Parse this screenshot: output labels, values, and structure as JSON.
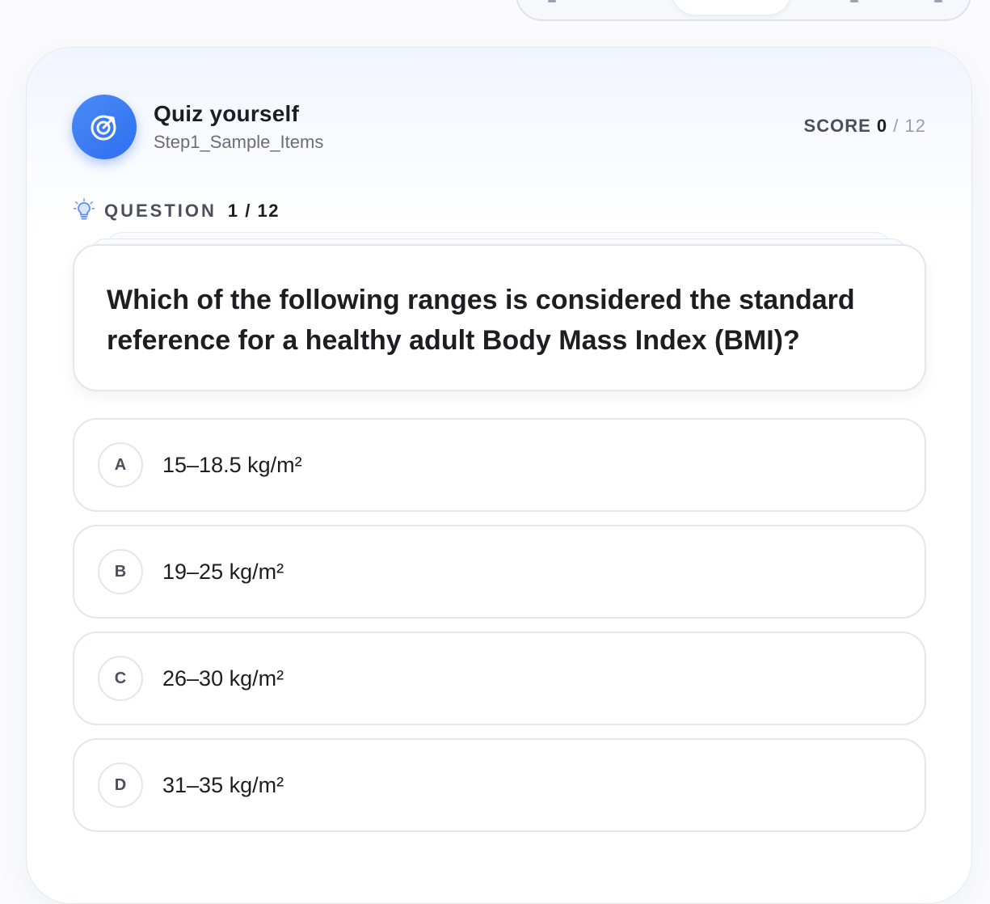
{
  "header": {
    "title": "Quiz yourself",
    "subtitle": "Step1_Sample_Items",
    "score_label": "SCORE",
    "score_value": "0",
    "score_total": "/ 12"
  },
  "question": {
    "label": "QUESTION",
    "number": "1 / 12",
    "text": "Which of the following ranges is considered the standard reference for a healthy adult Body Mass Index (BMI)?"
  },
  "options": [
    {
      "letter": "A",
      "text": "15–18.5 kg/m²"
    },
    {
      "letter": "B",
      "text": "19–25 kg/m²"
    },
    {
      "letter": "C",
      "text": "26–30 kg/m²"
    },
    {
      "letter": "D",
      "text": "31–35 kg/m²"
    }
  ],
  "icons": {
    "logo": "target-icon",
    "question": "lightbulb-icon"
  },
  "colors": {
    "accent": "#3a7cf4",
    "border": "#e3e6ee",
    "text": "#1d1d22",
    "muted": "#6a6e7a"
  }
}
